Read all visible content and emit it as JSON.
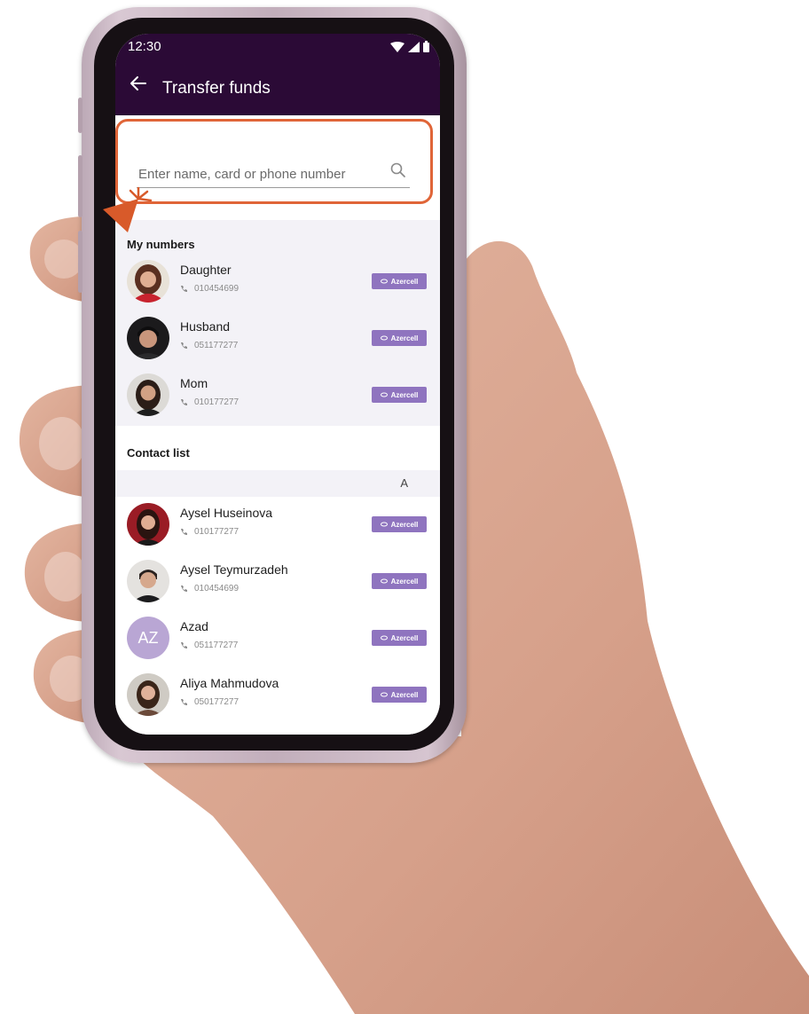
{
  "status_bar": {
    "time": "12:30",
    "icons": [
      "wifi-icon",
      "signal-icon",
      "battery-icon"
    ]
  },
  "header": {
    "title": "Transfer funds",
    "back_icon": "back-arrow-icon"
  },
  "search": {
    "placeholder": "Enter name, card or phone number",
    "value": "",
    "icon": "search-icon"
  },
  "my_numbers": {
    "title": "My numbers",
    "items": [
      {
        "name": "Daughter",
        "phone": "010454699",
        "operator": "Azercell"
      },
      {
        "name": "Husband",
        "phone": "051177277",
        "operator": "Azercell"
      },
      {
        "name": "Mom",
        "phone": "010177277",
        "operator": "Azercell"
      }
    ]
  },
  "contact_list": {
    "title": "Contact list",
    "letter": "A",
    "items": [
      {
        "name": "Aysel Huseinova",
        "phone": "010177277",
        "operator": "Azercell"
      },
      {
        "name": "Aysel Teymurzadeh",
        "phone": "010454699",
        "operator": "Azercell"
      },
      {
        "name": "Azad",
        "phone": "051177277",
        "operator": "Azercell",
        "initials": "AZ"
      },
      {
        "name": "Aliya Mahmudova",
        "phone": "050177277",
        "operator": "Azercell"
      }
    ]
  },
  "colors": {
    "header_bg": "#2b0a36",
    "badge_bg": "#8f74bf",
    "section_bg": "#f3f2f7",
    "highlight": "#e06538",
    "avatar_initials_bg": "#b9a6d4"
  }
}
